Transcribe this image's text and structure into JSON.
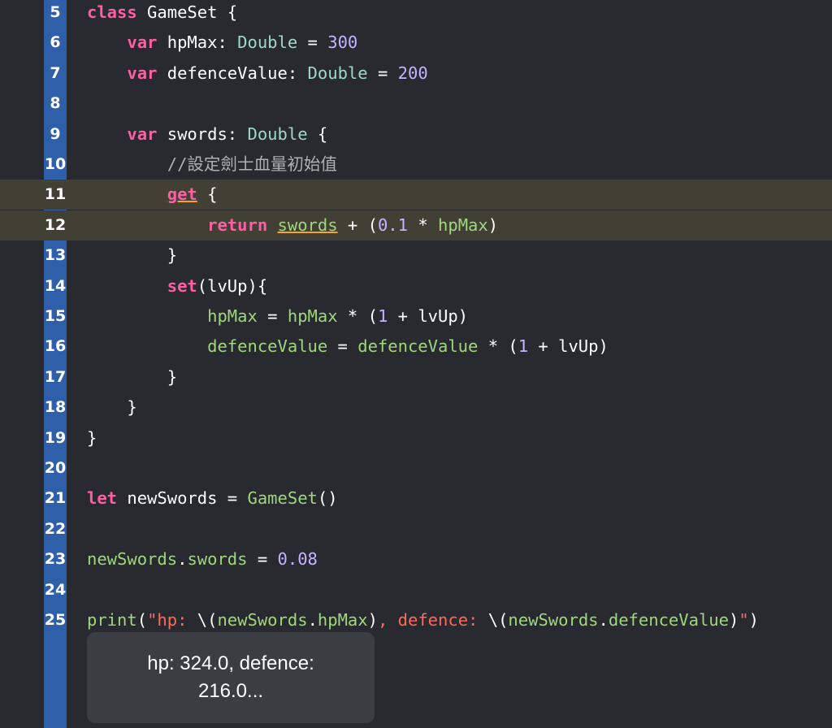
{
  "lines": [
    {
      "n": "5",
      "tokens": [
        [
          "kw",
          "class"
        ],
        [
          "pl",
          " GameSet {"
        ]
      ]
    },
    {
      "n": "6",
      "tokens": [
        [
          "pl",
          "    "
        ],
        [
          "kw",
          "var"
        ],
        [
          "pl",
          " hpMax: "
        ],
        [
          "ty",
          "Double"
        ],
        [
          "pl",
          " = "
        ],
        [
          "num",
          "300"
        ]
      ]
    },
    {
      "n": "7",
      "tokens": [
        [
          "pl",
          "    "
        ],
        [
          "kw",
          "var"
        ],
        [
          "pl",
          " defenceValue: "
        ],
        [
          "ty",
          "Double"
        ],
        [
          "pl",
          " = "
        ],
        [
          "num",
          "200"
        ]
      ]
    },
    {
      "n": "8",
      "tokens": []
    },
    {
      "n": "9",
      "tokens": [
        [
          "pl",
          "    "
        ],
        [
          "kw",
          "var"
        ],
        [
          "pl",
          " swords: "
        ],
        [
          "ty",
          "Double"
        ],
        [
          "pl",
          " {"
        ]
      ]
    },
    {
      "n": "10",
      "tokens": [
        [
          "pl",
          "        "
        ],
        [
          "cm",
          "//設定劍士血量初始值"
        ]
      ]
    },
    {
      "n": "11",
      "tokens": [
        [
          "pl",
          "        "
        ],
        [
          "kw",
          "get"
        ],
        [
          "pl",
          " {"
        ]
      ]
    },
    {
      "n": "12",
      "tokens": [
        [
          "pl",
          "            "
        ],
        [
          "kw",
          "return"
        ],
        [
          "pl",
          " "
        ],
        [
          "id",
          "swords"
        ],
        [
          "pl",
          " + ("
        ],
        [
          "num",
          "0.1"
        ],
        [
          "pl",
          " * "
        ],
        [
          "id",
          "hpMax"
        ],
        [
          "pl",
          ")"
        ]
      ]
    },
    {
      "n": "13",
      "tokens": [
        [
          "pl",
          "        }"
        ]
      ]
    },
    {
      "n": "14",
      "tokens": [
        [
          "pl",
          "        "
        ],
        [
          "kw",
          "set"
        ],
        [
          "pl",
          "(lvUp){"
        ]
      ]
    },
    {
      "n": "15",
      "tokens": [
        [
          "pl",
          "            "
        ],
        [
          "id",
          "hpMax"
        ],
        [
          "pl",
          " = "
        ],
        [
          "id",
          "hpMax"
        ],
        [
          "pl",
          " * ("
        ],
        [
          "num",
          "1"
        ],
        [
          "pl",
          " + lvUp)"
        ]
      ]
    },
    {
      "n": "16",
      "tokens": [
        [
          "pl",
          "            "
        ],
        [
          "id",
          "defenceValue"
        ],
        [
          "pl",
          " = "
        ],
        [
          "id",
          "defenceValue"
        ],
        [
          "pl",
          " * ("
        ],
        [
          "num",
          "1"
        ],
        [
          "pl",
          " + lvUp)"
        ]
      ]
    },
    {
      "n": "17",
      "tokens": [
        [
          "pl",
          "        }"
        ]
      ]
    },
    {
      "n": "18",
      "tokens": [
        [
          "pl",
          "    }"
        ]
      ]
    },
    {
      "n": "19",
      "tokens": [
        [
          "pl",
          "}"
        ]
      ]
    },
    {
      "n": "20",
      "tokens": []
    },
    {
      "n": "21",
      "tokens": [
        [
          "kw",
          "let"
        ],
        [
          "pl",
          " newSwords = "
        ],
        [
          "id",
          "GameSet"
        ],
        [
          "pl",
          "()"
        ]
      ]
    },
    {
      "n": "22",
      "tokens": []
    },
    {
      "n": "23",
      "tokens": [
        [
          "id",
          "newSwords"
        ],
        [
          "pl",
          "."
        ],
        [
          "id",
          "swords"
        ],
        [
          "pl",
          " = "
        ],
        [
          "num",
          "0.08"
        ]
      ]
    },
    {
      "n": "24",
      "tokens": []
    },
    {
      "n": "25",
      "tokens": [
        [
          "id",
          "print"
        ],
        [
          "pl",
          "("
        ],
        [
          "str",
          "\"hp: "
        ],
        [
          "pl",
          "\\("
        ],
        [
          "id",
          "newSwords"
        ],
        [
          "pl",
          "."
        ],
        [
          "id",
          "hpMax"
        ],
        [
          "pl",
          ")"
        ],
        [
          "str",
          ", defence: "
        ],
        [
          "pl",
          "\\("
        ],
        [
          "id",
          "newSwords"
        ],
        [
          "pl",
          "."
        ],
        [
          "id",
          "defenceValue"
        ],
        [
          "pl",
          ")"
        ],
        [
          "str",
          "\""
        ],
        [
          "pl",
          ")"
        ]
      ]
    }
  ],
  "highlighted_lines": [
    "11",
    "12"
  ],
  "result_popup": {
    "line1": "hp: 324.0, defence:",
    "line2": "216.0..."
  },
  "colors": {
    "background": "#292a30",
    "gutter": "#2f5fa8",
    "highlight": "#423f35",
    "keyword": "#fc5fa3",
    "type": "#a0d8c8",
    "number": "#c5b3ff",
    "identifier": "#9ed77e",
    "string": "#fc6a5d"
  }
}
